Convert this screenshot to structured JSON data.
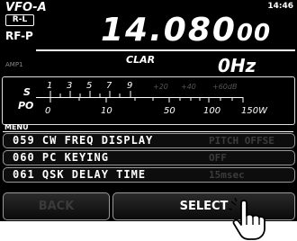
{
  "header": {
    "mode": "VFO-A",
    "vfo_badge": "R-L",
    "clock": "14:46",
    "frequency_main": "14.080",
    "frequency_sub": "00",
    "rf_label": "RF-P",
    "amp_label": "AMP1"
  },
  "clar": {
    "label": "CLAR",
    "value": "0Hz"
  },
  "meter": {
    "s_label": "S",
    "s_scale": [
      "1",
      "3",
      "5",
      "7",
      "9",
      "+20",
      "+40",
      "+60dB"
    ],
    "po_label": "PO",
    "po_scale": [
      "0",
      "10",
      "50",
      "100",
      "150W"
    ]
  },
  "menu": {
    "label": "MENU",
    "items": [
      {
        "code": "059 CW FREQ DISPLAY",
        "value": "PITCH OFFSE"
      },
      {
        "code": "060 PC KEYING",
        "value": "OFF"
      },
      {
        "code": "061 QSK DELAY TIME",
        "value": "15msec"
      }
    ]
  },
  "buttons": {
    "back": "BACK",
    "select": "SELECT"
  },
  "colors": {
    "background": "#000000",
    "text": "#ffffff",
    "dim": "#555555",
    "hand": "#ffffff"
  },
  "icons": {
    "hand": "pointing-hand-icon"
  }
}
